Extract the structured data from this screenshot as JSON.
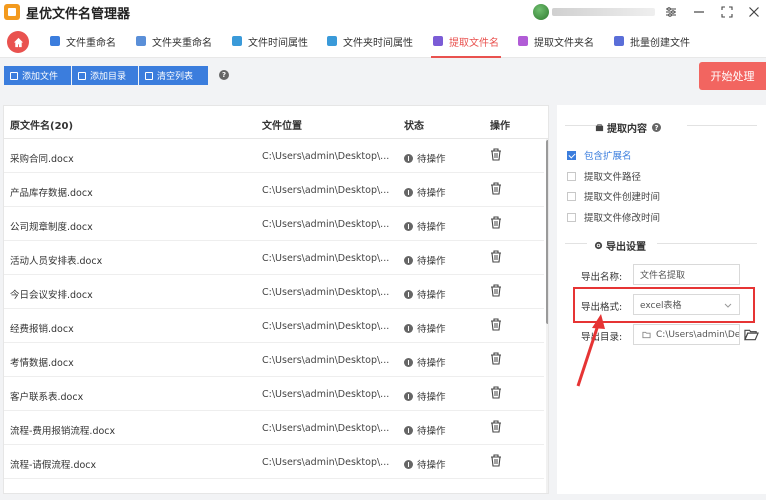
{
  "app": {
    "title": "星优文件名管理器"
  },
  "tabs": [
    {
      "label": "文件重命名",
      "color": "#3b7ddd"
    },
    {
      "label": "文件夹重命名",
      "color": "#5a8fd8"
    },
    {
      "label": "文件时间属性",
      "color": "#3a9ad9"
    },
    {
      "label": "文件夹时间属性",
      "color": "#3a9ad9"
    },
    {
      "label": "提取文件名",
      "color": "#7b5cd6"
    },
    {
      "label": "提取文件夹名",
      "color": "#b15cd6"
    },
    {
      "label": "批量创建文件",
      "color": "#5a6ed8"
    }
  ],
  "active_tab": "提取文件名",
  "toolbar": {
    "add_file": "添加文件",
    "add_dir": "添加目录",
    "clear_list": "清空列表",
    "start": "开始处理"
  },
  "table": {
    "headers": {
      "name": "原文件名(20)",
      "location": "文件位置",
      "status": "状态",
      "action": "操作"
    },
    "rows": [
      {
        "name": "采购合同.docx",
        "location": "C:\\Users\\admin\\Desktop\\...",
        "status": "待操作"
      },
      {
        "name": "产品库存数据.docx",
        "location": "C:\\Users\\admin\\Desktop\\...",
        "status": "待操作"
      },
      {
        "name": "公司规章制度.docx",
        "location": "C:\\Users\\admin\\Desktop\\...",
        "status": "待操作"
      },
      {
        "name": "活动人员安排表.docx",
        "location": "C:\\Users\\admin\\Desktop\\...",
        "status": "待操作"
      },
      {
        "name": "今日会议安排.docx",
        "location": "C:\\Users\\admin\\Desktop\\...",
        "status": "待操作"
      },
      {
        "name": "经费报销.docx",
        "location": "C:\\Users\\admin\\Desktop\\...",
        "status": "待操作"
      },
      {
        "name": "考情数据.docx",
        "location": "C:\\Users\\admin\\Desktop\\...",
        "status": "待操作"
      },
      {
        "name": "客户联系表.docx",
        "location": "C:\\Users\\admin\\Desktop\\...",
        "status": "待操作"
      },
      {
        "name": "流程-费用报销流程.docx",
        "location": "C:\\Users\\admin\\Desktop\\...",
        "status": "待操作"
      },
      {
        "name": "流程-请假流程.docx",
        "location": "C:\\Users\\admin\\Desktop\\...",
        "status": "待操作"
      }
    ]
  },
  "extract": {
    "title": "提取内容",
    "options": [
      {
        "label": "包含扩展名",
        "checked": true
      },
      {
        "label": "提取文件路径",
        "checked": false
      },
      {
        "label": "提取文件创建时间",
        "checked": false
      },
      {
        "label": "提取文件修改时间",
        "checked": false
      }
    ]
  },
  "export": {
    "title": "导出设置",
    "name_label": "导出名称:",
    "name_value": "文件名提取",
    "format_label": "导出格式:",
    "format_value": "excel表格",
    "dir_label": "导出目录:",
    "dir_value": "C:\\Users\\admin\\Des"
  },
  "colors": {
    "accent": "#e9524f",
    "primary": "#3b7ddd",
    "highlight": "#e63434"
  }
}
